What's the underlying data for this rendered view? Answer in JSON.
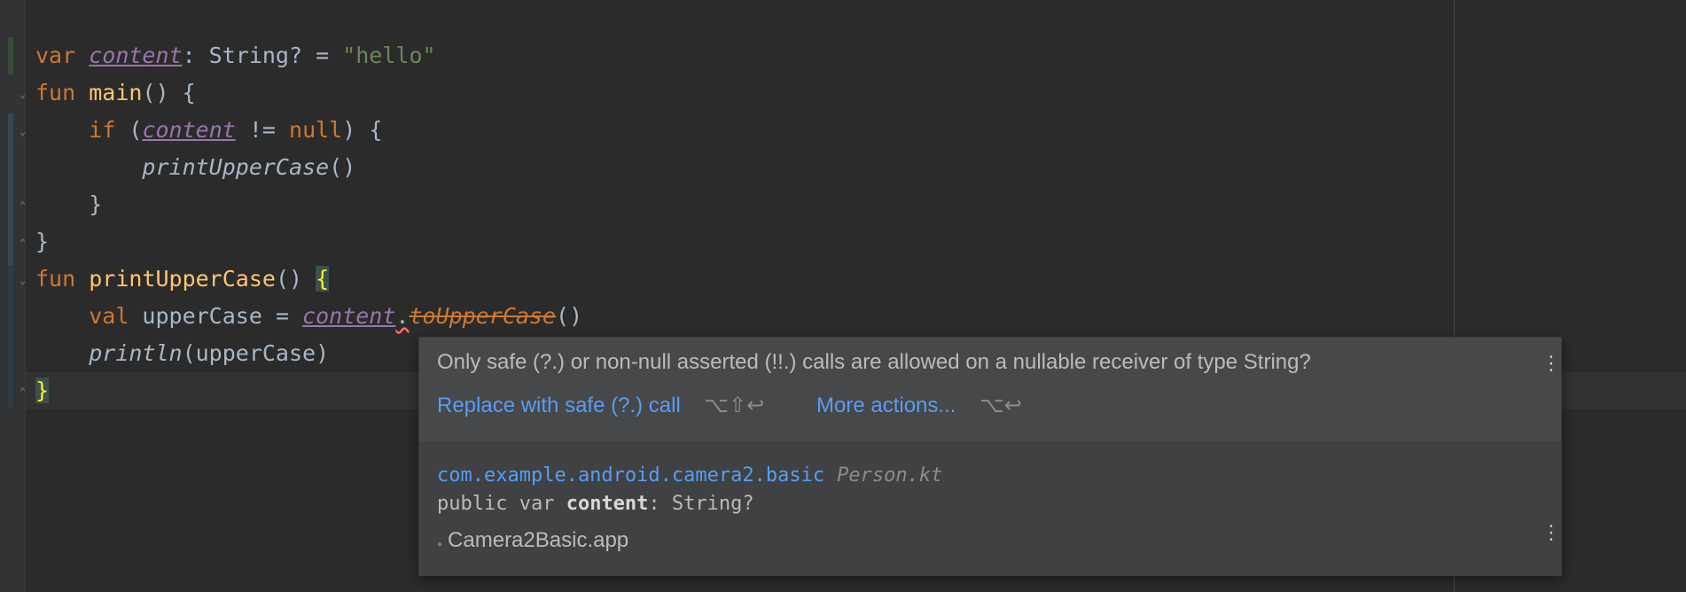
{
  "editor": {
    "lines": [
      [
        "var",
        " ",
        "content",
        ": String? = ",
        "\"hello\""
      ],
      [
        "fun",
        " ",
        "main",
        "() {"
      ],
      [
        "    ",
        "if",
        " (",
        "content",
        " != ",
        "null",
        ") {"
      ],
      [
        "        ",
        "printUpperCase",
        "()"
      ],
      [
        "    }"
      ],
      [
        "}"
      ],
      [
        "fun",
        " ",
        "printUpperCase",
        "() ",
        "{"
      ],
      [
        "    ",
        "val",
        " upperCase = ",
        "content",
        ".",
        "toUpperCase",
        "()"
      ],
      [
        "    ",
        "println",
        "(upperCase)"
      ],
      [
        "}"
      ]
    ]
  },
  "popup": {
    "message": "Only safe (?.) or non-null asserted (!!.) calls are allowed on a nullable receiver of type String?",
    "primary_action": "Replace with safe (?.) call",
    "primary_shortcut": "⌥⇧↩",
    "more_action": "More actions...",
    "more_shortcut": "⌥↩",
    "package": "com.example.android.camera2.basic",
    "file": "Person.kt",
    "signature_prefix": "public var ",
    "signature_name": "content",
    "signature_suffix": ": String?",
    "module": "Camera2Basic.app",
    "menu_icon": "vertical-ellipsis-icon"
  },
  "colors": {
    "background": "#2b2b2b",
    "keyword": "#cc7832",
    "function": "#ffc66d",
    "string": "#6a8759",
    "property": "#9876aa",
    "link": "#589df6",
    "error": "#ff6b68"
  }
}
